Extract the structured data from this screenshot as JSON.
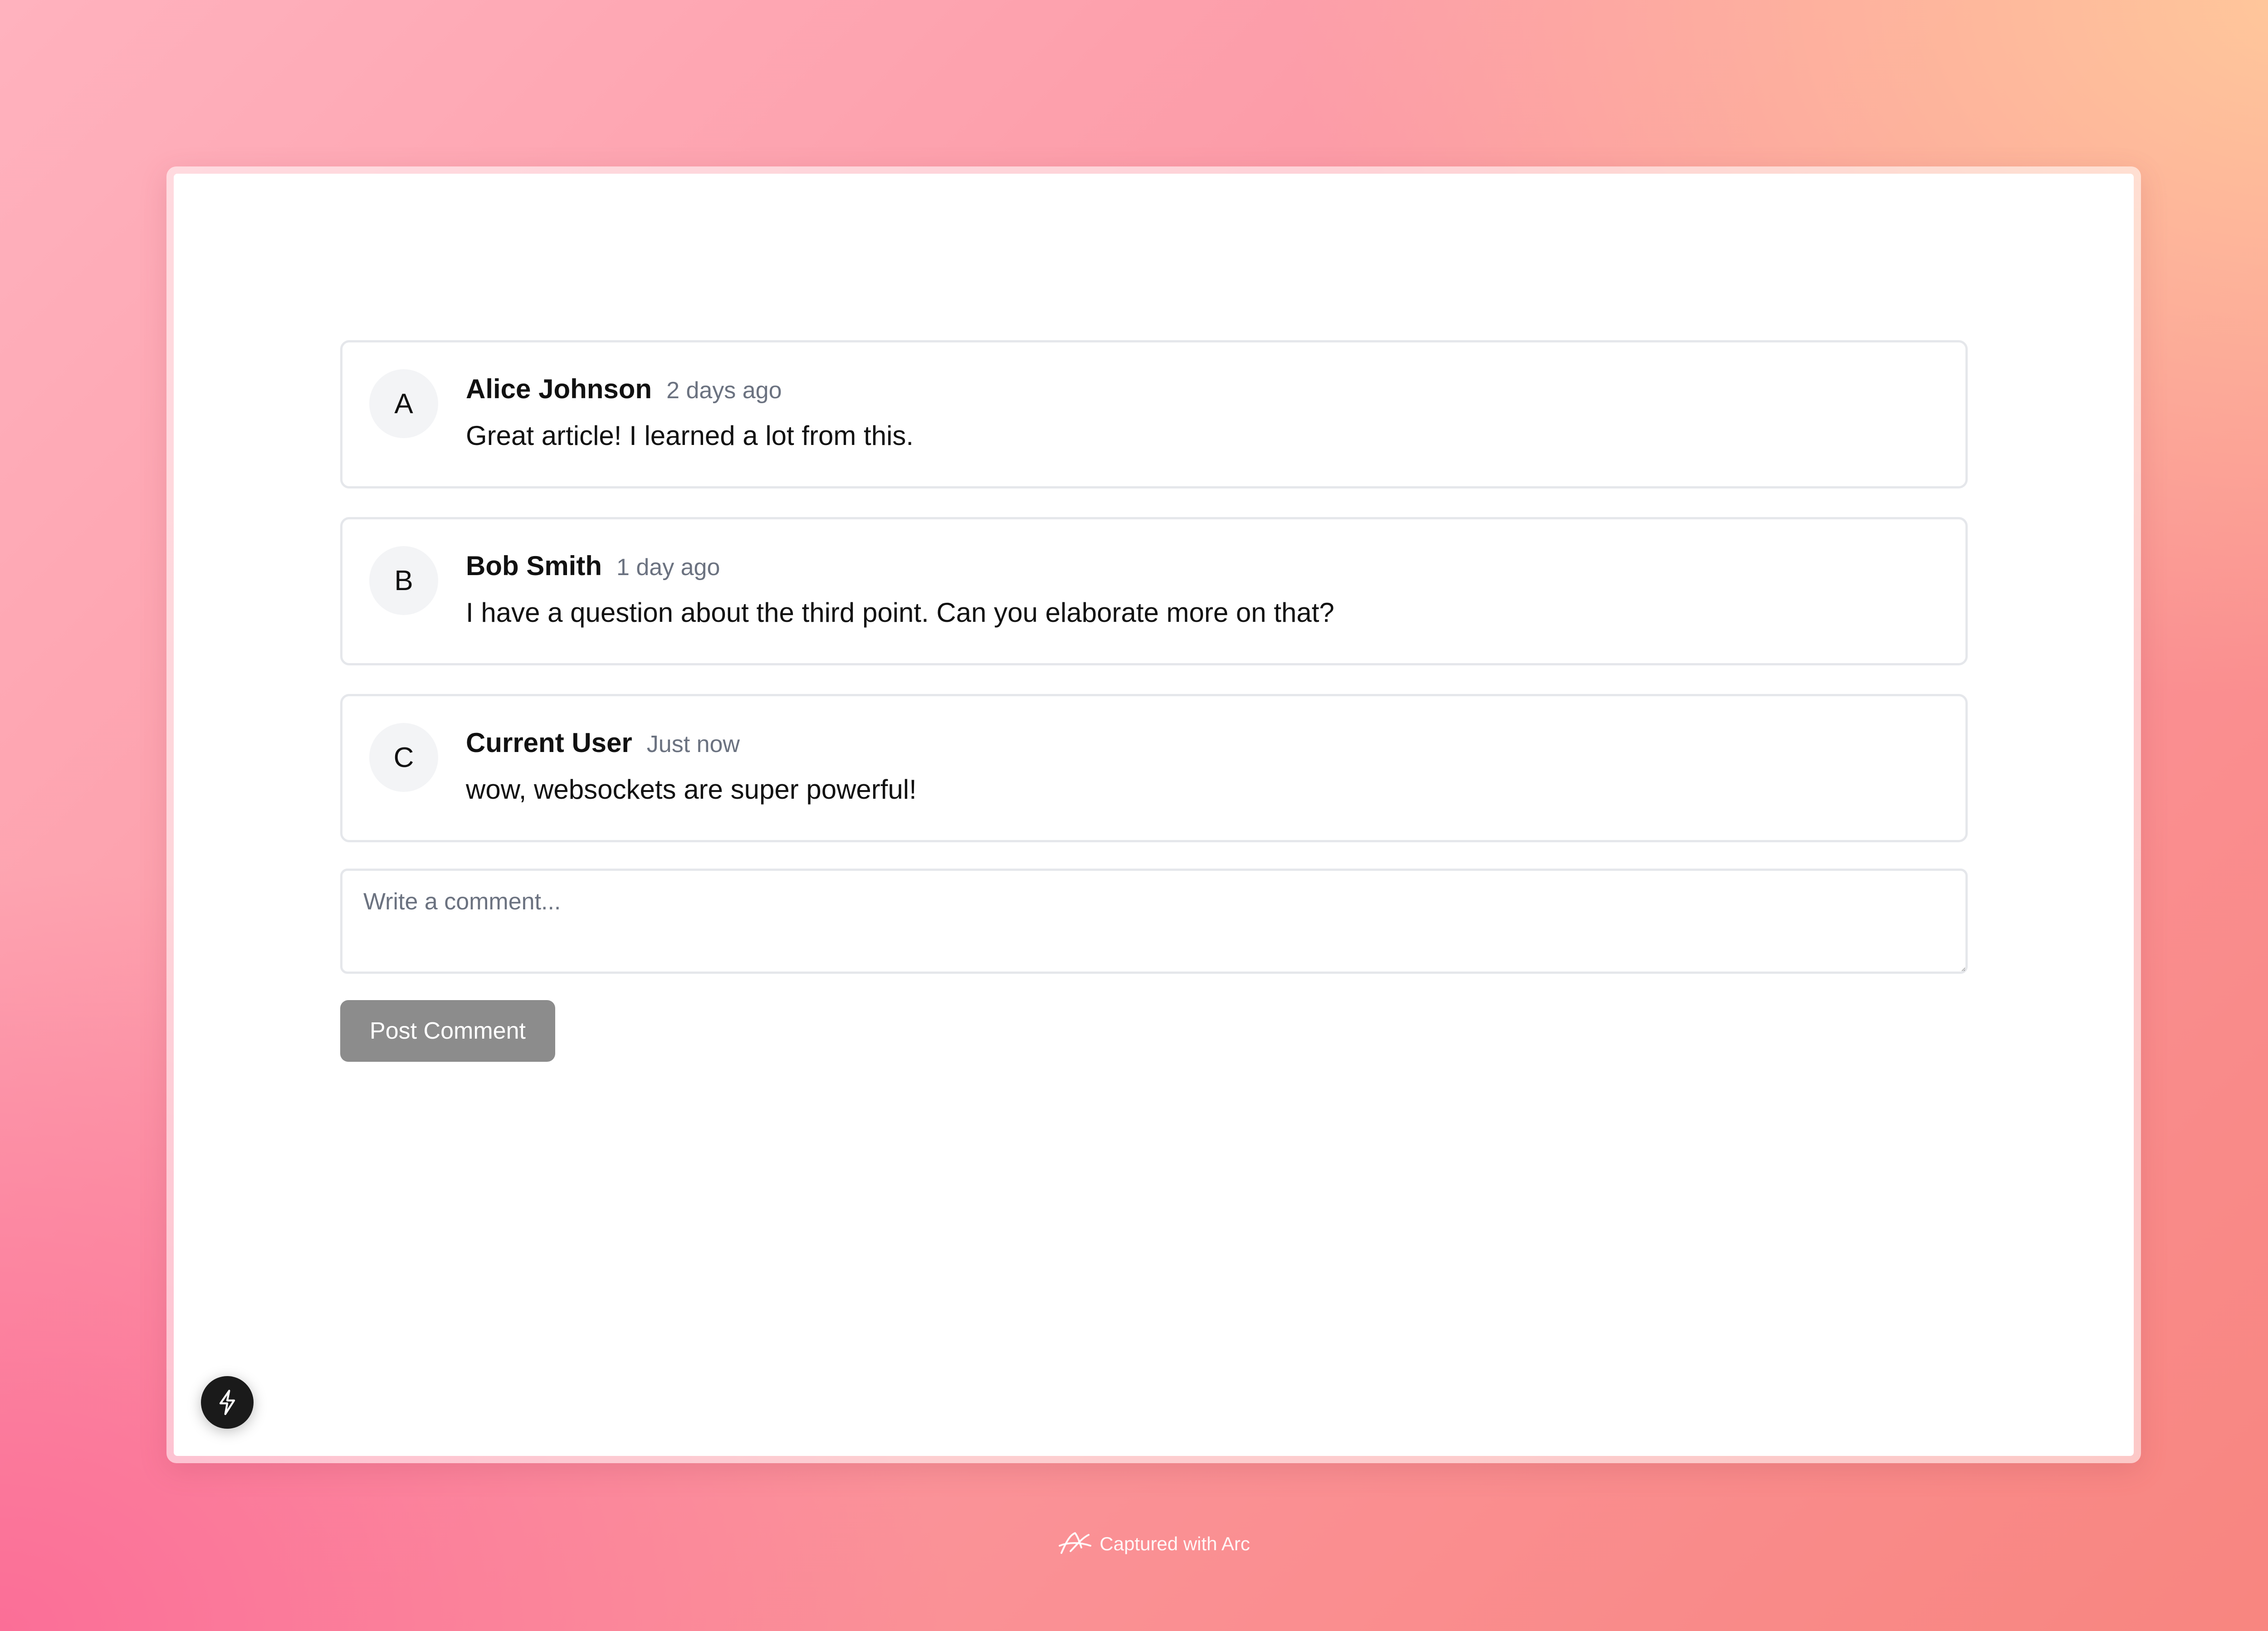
{
  "comments": [
    {
      "avatar_letter": "A",
      "author": "Alice Johnson",
      "time": "2 days ago",
      "text": "Great article! I learned a lot from this."
    },
    {
      "avatar_letter": "B",
      "author": "Bob Smith",
      "time": "1 day ago",
      "text": "I have a question about the third point. Can you elaborate more on that?"
    },
    {
      "avatar_letter": "C",
      "author": "Current User",
      "time": "Just now",
      "text": "wow, websockets are super powerful!"
    }
  ],
  "composer": {
    "placeholder": "Write a comment...",
    "value": "",
    "submit_label": "Post Comment"
  },
  "dev_indicator": {
    "icon": "lightning-bolt-icon"
  },
  "footer": {
    "credit": "Captured with Arc",
    "icon": "arc-logo-icon"
  },
  "colors": {
    "button_background": "#8c8c8c",
    "card_border": "#e5e7eb",
    "avatar_background": "#f3f4f6",
    "muted_text": "#6b7280"
  }
}
